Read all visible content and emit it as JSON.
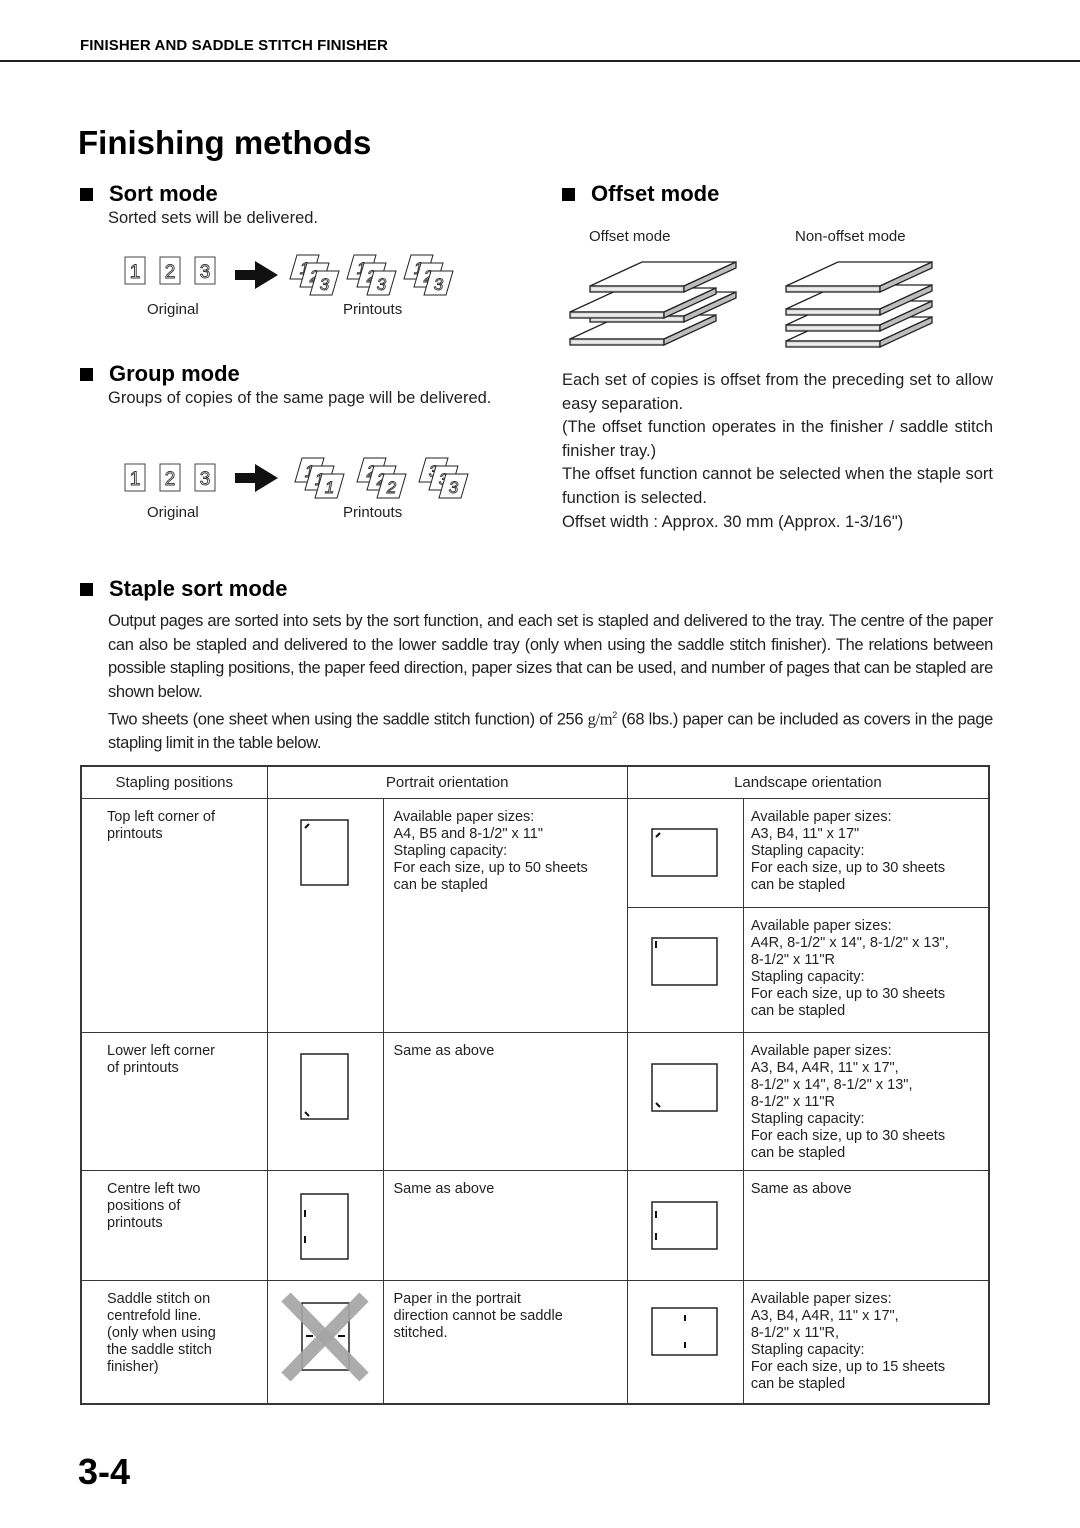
{
  "running_head": "FINISHER AND SADDLE STITCH FINISHER",
  "page_title": "Finishing methods",
  "sort_mode": {
    "heading": "Sort mode",
    "description": "Sorted sets will be delivered.",
    "original_label": "Original",
    "printouts_label": "Printouts",
    "original_pages": [
      "1",
      "2",
      "3"
    ],
    "printout_sets": [
      [
        "1",
        "2",
        "3"
      ],
      [
        "1",
        "2",
        "3"
      ],
      [
        "1",
        "2",
        "3"
      ]
    ]
  },
  "group_mode": {
    "heading": "Group mode",
    "description": "Groups of copies of the same page will be delivered.",
    "original_label": "Original",
    "printouts_label": "Printouts",
    "original_pages": [
      "1",
      "2",
      "3"
    ],
    "printout_sets": [
      [
        "1",
        "1",
        "1"
      ],
      [
        "2",
        "2",
        "2"
      ],
      [
        "3",
        "3",
        "3"
      ]
    ]
  },
  "offset_mode": {
    "heading": "Offset mode",
    "offset_label": "Offset mode",
    "non_offset_label": "Non-offset mode",
    "paragraphs": [
      "Each set of copies is offset from the preceding set to allow easy separation.",
      "(The offset function operates in the finisher / saddle stitch finisher tray.)",
      "The offset function cannot be selected when the staple sort function is selected.",
      "Offset width : Approx. 30 mm (Approx. 1-3/16\")"
    ]
  },
  "staple_sort_mode": {
    "heading": "Staple sort mode",
    "paragraph_1": "Output pages are sorted into sets by the sort function, and each set is stapled and delivered to the tray. The centre of the paper can also be stapled and delivered to the lower saddle tray (only when using the saddle stitch finisher). The relations between possible stapling positions, the paper feed direction, paper sizes that can be used, and number of pages that can be stapled are shown below.",
    "paragraph_2_before": "Two sheets (one sheet when using the saddle stitch function) of 256 ",
    "paragraph_2_unit": "g/m",
    "paragraph_2_sup": "2",
    "paragraph_2_after": " (68 lbs.) paper can be included as covers in the page stapling limit in the table below."
  },
  "table": {
    "headers": [
      "Stapling positions",
      "Portrait orientation",
      "Landscape orientation"
    ],
    "rows": [
      {
        "position": "Top left corner of\nprintouts",
        "portrait_icon": "portrait-staple-top-left",
        "portrait_text": "Available paper sizes:\nA4, B5 and 8-1/2\" x 11\"\nStapling capacity:\nFor each size, up to 50 sheets\ncan be stapled",
        "landscape": [
          {
            "icon": "landscape-staple-top-left-diagonal",
            "text": "Available paper sizes:\nA3, B4, 11\" x 17\"\nStapling capacity:\nFor each size, up to 30 sheets\ncan be stapled"
          },
          {
            "icon": "landscape-staple-top-left-vertical",
            "text": "Available paper sizes:\nA4R, 8-1/2\" x 14\", 8-1/2\" x 13\",\n8-1/2\" x 11\"R\nStapling capacity:\nFor each size, up to 30 sheets\ncan be stapled"
          }
        ]
      },
      {
        "position": "Lower left corner\nof printouts",
        "portrait_icon": "portrait-staple-lower-left",
        "portrait_text": "Same as above",
        "landscape": [
          {
            "icon": "landscape-staple-lower-left",
            "text": "Available paper sizes:\nA3, B4, A4R, 11\" x 17\",\n8-1/2\" x 14\", 8-1/2\" x 13\",\n8-1/2\" x 11\"R\nStapling capacity:\nFor each size, up to 30 sheets\ncan be stapled"
          }
        ]
      },
      {
        "position": "Centre left two\npositions of\nprintouts",
        "portrait_icon": "portrait-staple-centre-left-two",
        "portrait_text": "Same as above",
        "landscape": [
          {
            "icon": "landscape-staple-centre-left-two",
            "text": "Same as above"
          }
        ]
      },
      {
        "position": "Saddle stitch on\ncentrefold line.\n(only when using\nthe saddle stitch\nfinisher)",
        "portrait_icon": "portrait-saddle-stitch-not-available",
        "portrait_text": "Paper in the portrait\ndirection cannot be saddle\nstitched.",
        "landscape": [
          {
            "icon": "landscape-saddle-stitch-centre",
            "text": "Available paper sizes:\nA3, B4, A4R, 11\" x 17\",\n8-1/2\" x 11\"R,\nStapling capacity:\nFor each size, up to 15 sheets\ncan be stapled"
          }
        ]
      }
    ]
  },
  "page_number": "3-4"
}
